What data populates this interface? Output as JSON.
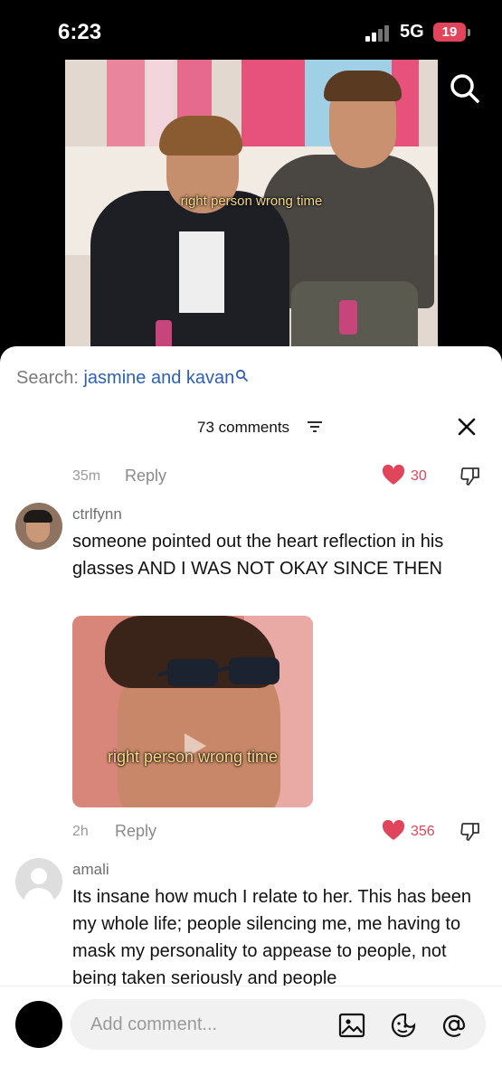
{
  "status_bar": {
    "time": "6:23",
    "network": "5G",
    "battery": "19"
  },
  "video": {
    "caption": "right person wrong time"
  },
  "comments_panel": {
    "search_label": "Search: ",
    "search_query": "jasmine and kavan",
    "count_label": "73 comments",
    "close_icon": "close-icon",
    "filter_icon": "filter-icon"
  },
  "comments": [
    {
      "time": "35m",
      "reply_label": "Reply",
      "likes": "30"
    },
    {
      "username": "ctrlfynn",
      "text": "someone pointed out the heart reflection in his glasses AND I WAS NOT OKAY SINCE THEN",
      "attachment_caption": "right person wrong time",
      "time": "2h",
      "reply_label": "Reply",
      "likes": "356"
    },
    {
      "username": "amali",
      "text": "Its insane how much I relate to her. This has been my whole life; people silencing me, me having to mask my personality to appease to people, not being taken seriously and people"
    }
  ],
  "composer": {
    "placeholder": "Add comment...",
    "icons": [
      "image-icon",
      "emoji-icon",
      "mention-icon"
    ]
  },
  "colors": {
    "accent_like": "#e0455c",
    "search_link": "#2e5fb7",
    "battery": "#e0455c"
  }
}
